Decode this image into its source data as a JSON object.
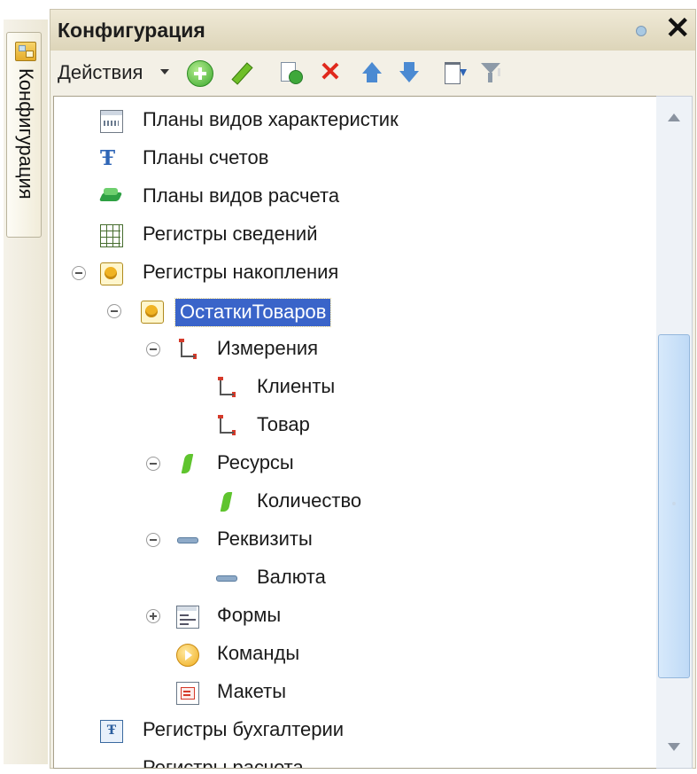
{
  "side_tab": {
    "label": "Конфигурация",
    "icon": "configuration-icon"
  },
  "panel": {
    "title": "Конфигурация"
  },
  "toolbar": {
    "actions_label": "Действия",
    "buttons": [
      "add-icon",
      "edit-icon",
      "copy-icon",
      "delete-icon",
      "move-up-icon",
      "move-down-icon",
      "sort-list-icon",
      "filter-icon"
    ]
  },
  "tree": {
    "items": [
      {
        "label": "Планы видов характеристик",
        "icon": "characteristic-types-icon"
      },
      {
        "label": "Планы счетов",
        "icon": "chart-of-accounts-icon"
      },
      {
        "label": "Планы видов расчета",
        "icon": "calculation-types-icon"
      },
      {
        "label": "Регистры сведений",
        "icon": "information-register-icon"
      },
      {
        "label": "Регистры накопления",
        "icon": "accumulation-register-icon",
        "expanded": true
      },
      {
        "label": "ОстаткиТоваров",
        "icon": "accumulation-register-icon",
        "expanded": true,
        "selected": true
      },
      {
        "label": "Измерения",
        "icon": "dimensions-icon",
        "expanded": true
      },
      {
        "label": "Клиенты",
        "icon": "dimension-icon"
      },
      {
        "label": "Товар",
        "icon": "dimension-icon"
      },
      {
        "label": "Ресурсы",
        "icon": "resources-icon",
        "expanded": true
      },
      {
        "label": "Количество",
        "icon": "resource-icon"
      },
      {
        "label": "Реквизиты",
        "icon": "attributes-icon",
        "expanded": true
      },
      {
        "label": "Валюта",
        "icon": "attribute-icon"
      },
      {
        "label": "Формы",
        "icon": "forms-icon",
        "expanded": false
      },
      {
        "label": "Команды",
        "icon": "commands-icon"
      },
      {
        "label": "Макеты",
        "icon": "templates-icon"
      },
      {
        "label": "Регистры бухгалтерии",
        "icon": "accounting-register-icon"
      },
      {
        "label": "Регистры расчета",
        "icon": "calculation-register-icon"
      }
    ]
  },
  "colors": {
    "selection": "#3a64c9",
    "panel_bg": "#f3f0e6",
    "scroll_thumb": "#bfdaf6"
  }
}
